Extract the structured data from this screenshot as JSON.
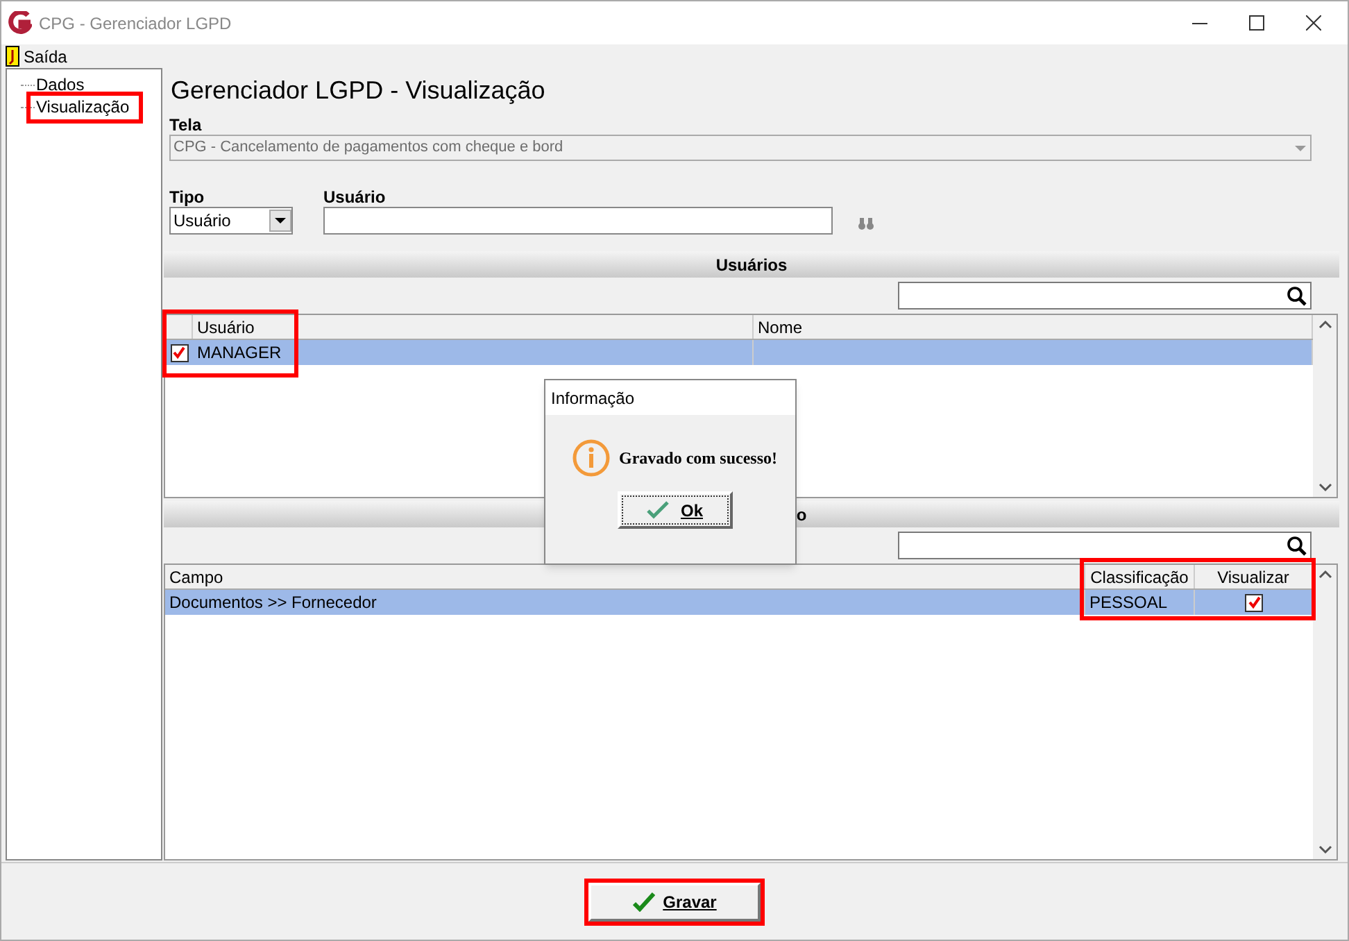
{
  "window": {
    "title": "CPG - Gerenciador LGPD"
  },
  "menu": [
    {
      "label": "Saída"
    }
  ],
  "tree": [
    {
      "label": "Dados",
      "selected": false,
      "highlighted": false
    },
    {
      "label": "Visualização",
      "selected": false,
      "highlighted": true
    }
  ],
  "heading": "Gerenciador LGPD - Visualização",
  "tela": {
    "label": "Tela",
    "value": "CPG - Cancelamento de pagamentos com cheque e bord",
    "disabled": true
  },
  "tipo": {
    "label": "Tipo",
    "value": "Usuário"
  },
  "usuario": {
    "label": "Usuário"
  },
  "users_section": {
    "title": "Usuários",
    "columns": [
      "Usuário",
      "Nome"
    ],
    "rows": [
      {
        "checked": true,
        "selected": true,
        "cells": [
          "MANAGER",
          ""
        ]
      }
    ],
    "highlighted": true
  },
  "fields_section": {
    "title": "o",
    "columns": [
      "Campo",
      "Classificação",
      "Visualizar"
    ],
    "rows": [
      {
        "selected": true,
        "cells": [
          "Documentos >> Fornecedor",
          "PESSOAL"
        ],
        "checked": true
      }
    ],
    "highlighted": true
  },
  "dialog": {
    "title": "Informação",
    "message": "Gravado com sucesso!",
    "button": "Ok"
  },
  "save_button": {
    "label": "Gravar",
    "highlighted": true
  }
}
